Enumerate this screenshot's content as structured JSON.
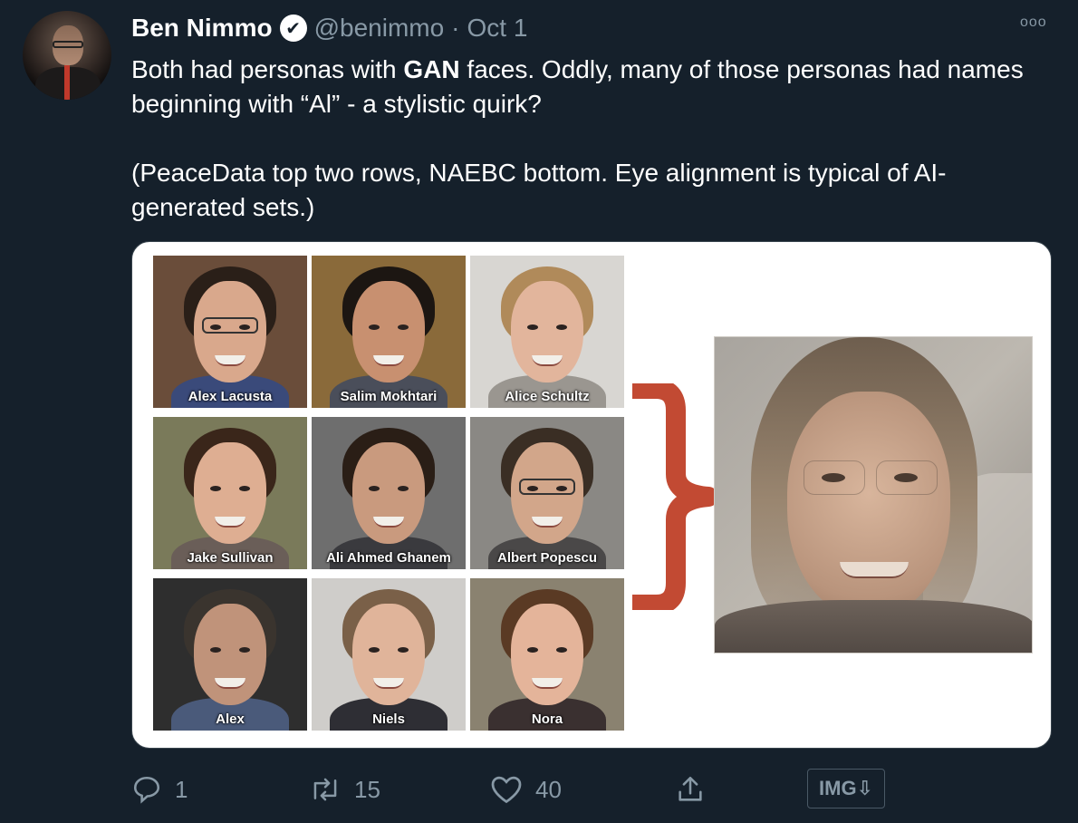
{
  "author": {
    "name": "Ben Nimmo",
    "handle": "@benimmo",
    "separator": "·",
    "date": "Oct 1",
    "verified_icon": "✔"
  },
  "more_label": "ooo",
  "tweet": {
    "line1_pre": "Both had personas with ",
    "line1_bold": "GAN",
    "line1_post": " faces. Oddly, many of those personas had names beginning with “Al” - a stylistic quirk?",
    "para2": "(PeaceData top two rows, NAEBC bottom. Eye alignment is typical of AI-generated sets.)"
  },
  "media": {
    "faces": [
      {
        "label": "Alex Lacusta",
        "bg": "#6a4d3a",
        "hair": "#2a1f18",
        "skin": "#d9a88c",
        "neck": "#3a4a7a",
        "glasses": true
      },
      {
        "label": "Salim Mokhtari",
        "bg": "#8a6a3a",
        "hair": "#1c1612",
        "skin": "#c89070",
        "neck": "#4a4e5a",
        "glasses": false
      },
      {
        "label": "Alice Schultz",
        "bg": "#d8d6d2",
        "hair": "#b08a5a",
        "skin": "#e2b59c",
        "neck": "#9a9690",
        "glasses": false
      },
      {
        "label": "Jake Sullivan",
        "bg": "#7a7a5a",
        "hair": "#3a261a",
        "skin": "#deae92",
        "neck": "#6a5e58",
        "glasses": false
      },
      {
        "label": "Ali Ahmed Ghanem",
        "bg": "#6e6e6e",
        "hair": "#2a1e16",
        "skin": "#c99a7e",
        "neck": "#3a3a3e",
        "glasses": false
      },
      {
        "label": "Albert Popescu",
        "bg": "#8a8884",
        "hair": "#3a2e24",
        "skin": "#d2a68a",
        "neck": "#4a4848",
        "glasses": true
      },
      {
        "label": "Alex",
        "bg": "#2e2e2e",
        "hair": "#3a342e",
        "skin": "#c0937a",
        "neck": "#4a5a7a",
        "glasses": false
      },
      {
        "label": "Niels",
        "bg": "#cfcdca",
        "hair": "#7a6048",
        "skin": "#e0b49a",
        "neck": "#2e2e34",
        "glasses": false
      },
      {
        "label": "Nora",
        "bg": "#8a8270",
        "hair": "#5a3a24",
        "skin": "#e4b49a",
        "neck": "#3a3030",
        "glasses": false
      }
    ],
    "brace_color": "#c24a33"
  },
  "actions": {
    "reply_count": "1",
    "retweet_count": "15",
    "like_count": "40",
    "img_label": "IMG⇩"
  }
}
